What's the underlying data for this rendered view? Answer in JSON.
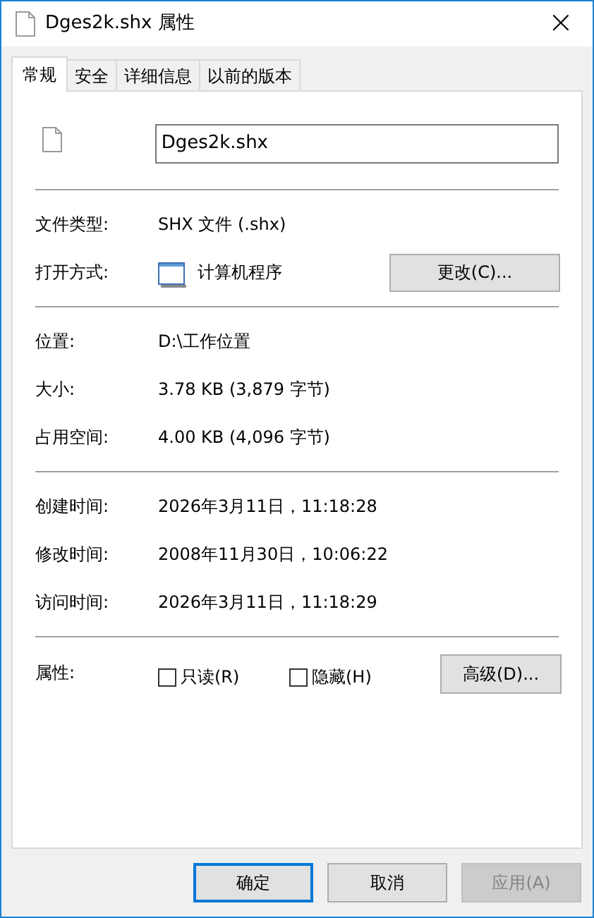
{
  "window": {
    "title": "Dges2k.shx 属性",
    "close": "×"
  },
  "tabs": [
    {
      "label": "常规",
      "selected": true
    },
    {
      "label": "安全",
      "selected": false
    },
    {
      "label": "详细信息",
      "selected": false
    },
    {
      "label": "以前的版本",
      "selected": false
    }
  ],
  "file_name": {
    "value": "Dges2k.shx"
  },
  "sections": [
    {
      "rows": [
        {
          "kind": "text",
          "label": "文件类型:",
          "value": "SHX 文件 (.shx)"
        },
        {
          "kind": "app",
          "label": "打开方式:",
          "value": "计算机程序",
          "button": "更改(C)..."
        }
      ]
    },
    {
      "rows": [
        {
          "kind": "text",
          "label": "位置:",
          "value": "D:\\工作位置"
        },
        {
          "kind": "text",
          "label": "大小:",
          "value": "3.78 KB (3,879 字节)"
        },
        {
          "kind": "text",
          "label": "占用空间:",
          "value": "4.00 KB (4,096 字节)"
        }
      ]
    },
    {
      "rows": [
        {
          "kind": "text",
          "label": "创建时间:",
          "value": "2026年3月11日，11:18:28"
        },
        {
          "kind": "text",
          "label": "修改时间:",
          "value": "2008年11月30日，10:06:22"
        },
        {
          "kind": "text",
          "label": "访问时间:",
          "value": "2026年3月11日，11:18:29"
        }
      ]
    }
  ],
  "attributes": {
    "label": "属性:",
    "checkboxes": [
      {
        "label": "只读(R)",
        "checked": false
      },
      {
        "label": "隐藏(H)",
        "checked": false
      }
    ],
    "button": "高级(D)..."
  },
  "buttons": [
    {
      "label": "确定",
      "default": true,
      "disabled": false
    },
    {
      "label": "取消",
      "default": false,
      "disabled": false
    },
    {
      "label": "应用(A)",
      "default": false,
      "disabled": true
    }
  ]
}
